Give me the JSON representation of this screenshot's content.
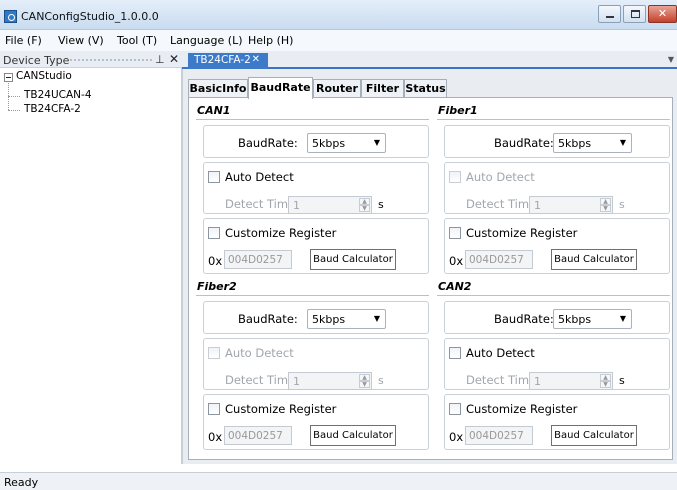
{
  "window": {
    "title": "CANConfigStudio_1.0.0.0"
  },
  "menu": [
    "File (F)",
    "View (V)",
    "Tool (T)",
    "Language (L)",
    "Help (H)"
  ],
  "device_panel": {
    "header": "Device Type",
    "root": "CANStudio",
    "children": [
      "TB24UCAN-4",
      "TB24CFA-2"
    ]
  },
  "doc_tab": {
    "label": "TB24CFA-2"
  },
  "tabs": [
    "BasicInfo",
    "BaudRate",
    "Router",
    "Filter",
    "Status"
  ],
  "active_tab": "BaudRate",
  "common": {
    "baudrate_label": "BaudRate:",
    "auto_detect_label": "Auto Detect",
    "detect_timeout_label": "Detect Timeout:",
    "unit": "s",
    "customize_label": "Customize Register",
    "reg_prefix": "0x",
    "baud_calc_label": "Baud Calculator"
  },
  "groups": [
    {
      "title": "CAN1",
      "baudrate": "5kbps",
      "auto_detect_enabled": true,
      "auto_detect_checked": false,
      "timeout": "1",
      "register": "004D0257",
      "customize_checked": false
    },
    {
      "title": "Fiber1",
      "baudrate": "5kbps",
      "auto_detect_enabled": false,
      "auto_detect_checked": false,
      "timeout": "1",
      "register": "004D0257",
      "customize_checked": false
    },
    {
      "title": "Fiber2",
      "baudrate": "5kbps",
      "auto_detect_enabled": false,
      "auto_detect_checked": false,
      "timeout": "1",
      "register": "004D0257",
      "customize_checked": false
    },
    {
      "title": "CAN2",
      "baudrate": "5kbps",
      "auto_detect_enabled": true,
      "auto_detect_checked": false,
      "timeout": "1",
      "register": "004D0257",
      "customize_checked": false
    }
  ],
  "status": {
    "text": "Ready"
  },
  "colors": {
    "accent": "#3d7ac9",
    "panel_bg": "#e9edf2"
  }
}
